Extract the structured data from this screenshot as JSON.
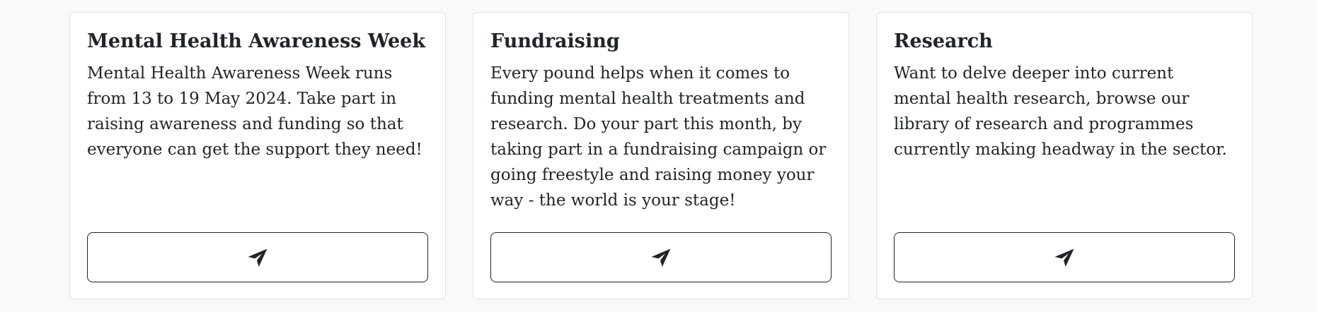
{
  "cards": [
    {
      "title": "Mental Health Awareness Week",
      "text": "Mental Health Awareness Week runs from 13 to 19 May 2024. Take part in raising awareness and funding so that everyone can get the support they need!",
      "button_icon": "send-icon"
    },
    {
      "title": "Fundraising",
      "text": "Every pound helps when it comes to funding mental health treatments and research. Do your part this month, by taking part in a fundraising campaign or going freestyle and raising money your way - the world is your stage!",
      "button_icon": "send-icon"
    },
    {
      "title": "Research",
      "text": "Want to delve deeper into current mental health research, browse our library of research and programmes currently making headway in the sector.",
      "button_icon": "send-icon"
    }
  ],
  "colors": {
    "page_background": "#f8f9fa",
    "card_background": "#ffffff",
    "card_border": "#dee2e6",
    "text": "#212529"
  }
}
